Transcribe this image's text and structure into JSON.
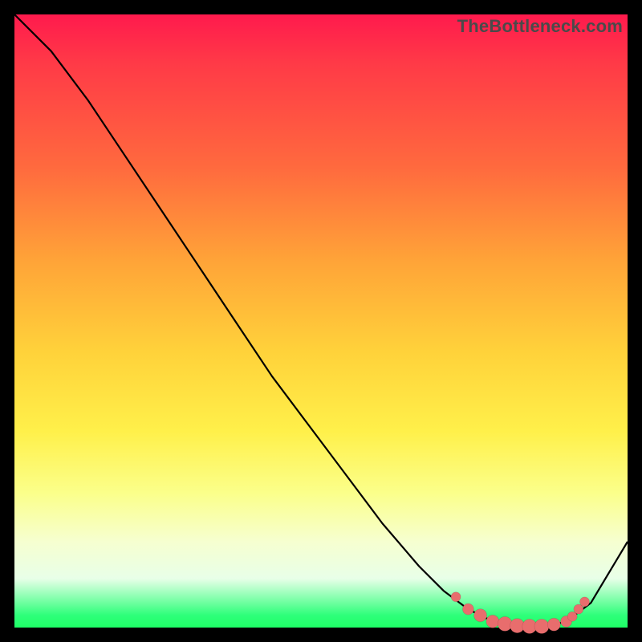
{
  "watermark": "TheBottleneck.com",
  "colors": {
    "curve": "#000000",
    "dot": "#e86d6d",
    "gradient_top": "#ff1a4d",
    "gradient_bottom": "#1eff66"
  },
  "chart_data": {
    "type": "line",
    "title": "",
    "xlabel": "",
    "ylabel": "",
    "xlim": [
      0,
      100
    ],
    "ylim": [
      0,
      100
    ],
    "grid": false,
    "legend": false,
    "annotations": [
      "TheBottleneck.com"
    ],
    "series": [
      {
        "name": "bottleneck-curve",
        "x": [
          0,
          6,
          12,
          18,
          24,
          30,
          36,
          42,
          48,
          54,
          60,
          66,
          70,
          74,
          78,
          82,
          86,
          90,
          94,
          100
        ],
        "y": [
          100,
          94,
          86,
          77,
          68,
          59,
          50,
          41,
          33,
          25,
          17,
          10,
          6,
          3,
          1,
          0,
          0,
          1,
          4,
          14
        ]
      }
    ],
    "highlighted_points": {
      "name": "optimal-range",
      "x": [
        72,
        74,
        76,
        78,
        80,
        82,
        84,
        86,
        88,
        90,
        91,
        92,
        93
      ],
      "y": [
        5,
        3,
        2,
        1,
        0.6,
        0.3,
        0.2,
        0.2,
        0.5,
        1,
        1.8,
        3,
        4.2
      ],
      "size": [
        6,
        7,
        8,
        8,
        9,
        9,
        9,
        9,
        8,
        7,
        6,
        6,
        6
      ]
    }
  }
}
